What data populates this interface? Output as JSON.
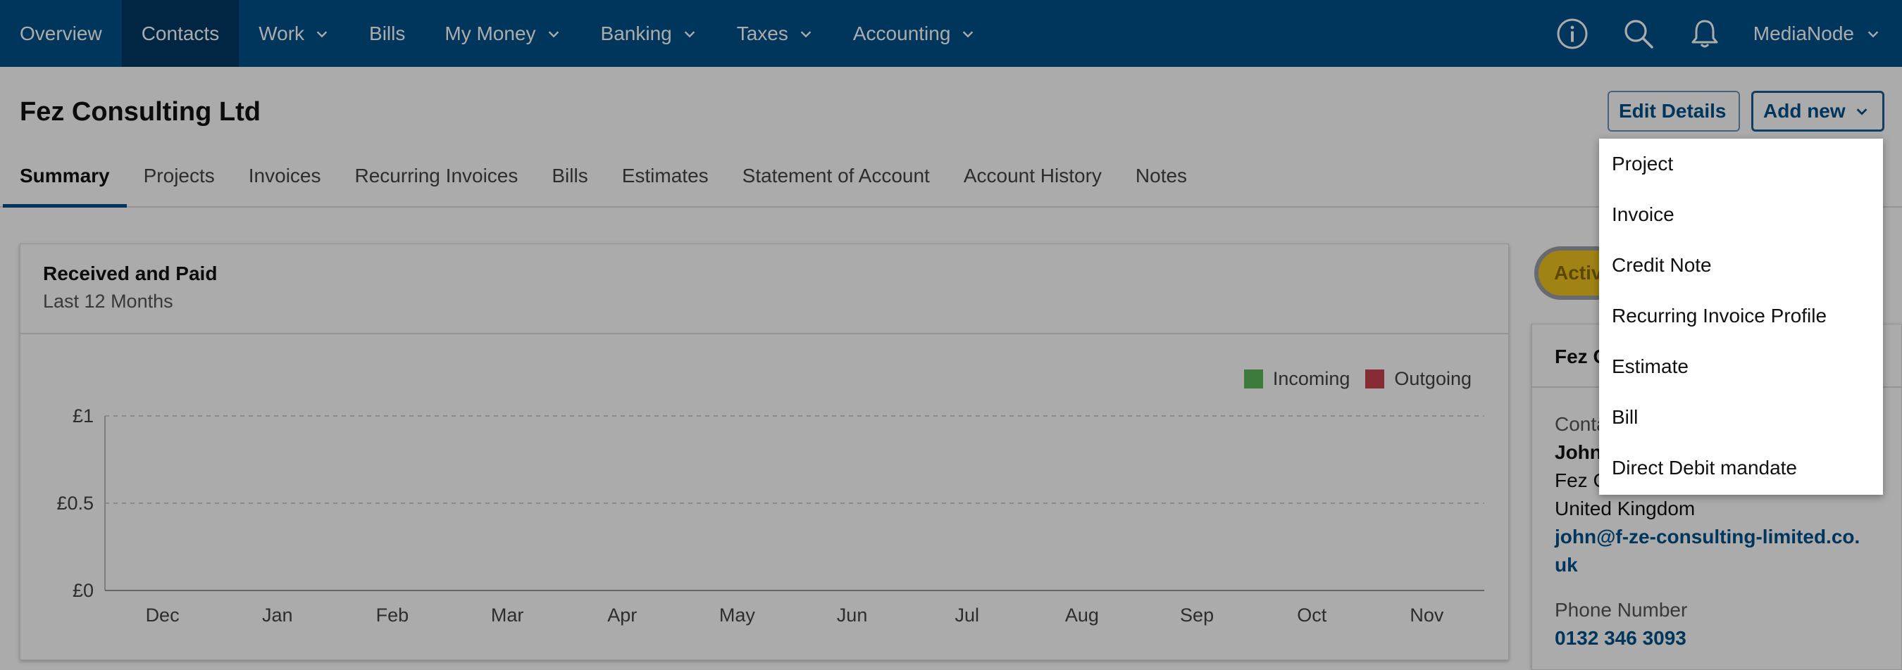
{
  "nav": {
    "items": [
      {
        "label": "Overview",
        "dropdown": false,
        "active": false
      },
      {
        "label": "Contacts",
        "dropdown": false,
        "active": true
      },
      {
        "label": "Work",
        "dropdown": true,
        "active": false
      },
      {
        "label": "Bills",
        "dropdown": false,
        "active": false
      },
      {
        "label": "My Money",
        "dropdown": true,
        "active": false
      },
      {
        "label": "Banking",
        "dropdown": true,
        "active": false
      },
      {
        "label": "Taxes",
        "dropdown": true,
        "active": false
      },
      {
        "label": "Accounting",
        "dropdown": true,
        "active": false
      }
    ],
    "account_label": "MediaNode",
    "icons": [
      "info-icon",
      "search-icon",
      "bell-icon"
    ]
  },
  "header": {
    "title": "Fez Consulting Ltd",
    "edit_label": "Edit Details",
    "add_label": "Add new"
  },
  "tabs": [
    {
      "label": "Summary",
      "active": true
    },
    {
      "label": "Projects",
      "active": false
    },
    {
      "label": "Invoices",
      "active": false
    },
    {
      "label": "Recurring Invoices",
      "active": false
    },
    {
      "label": "Bills",
      "active": false
    },
    {
      "label": "Estimates",
      "active": false
    },
    {
      "label": "Statement of Account",
      "active": false
    },
    {
      "label": "Account History",
      "active": false
    },
    {
      "label": "Notes",
      "active": false
    }
  ],
  "chart_card": {
    "title": "Received and Paid",
    "subtitle": "Last 12 Months"
  },
  "chart_data": {
    "type": "bar",
    "categories": [
      "Dec",
      "Jan",
      "Feb",
      "Mar",
      "Apr",
      "May",
      "Jun",
      "Jul",
      "Aug",
      "Sep",
      "Oct",
      "Nov"
    ],
    "series": [
      {
        "name": "Incoming",
        "color": "#5cb85c",
        "values": [
          0,
          0,
          0,
          0,
          0,
          0,
          0,
          0,
          0,
          0,
          0,
          0
        ]
      },
      {
        "name": "Outgoing",
        "color": "#c9404f",
        "values": [
          0,
          0,
          0,
          0,
          0,
          0,
          0,
          0,
          0,
          0,
          0,
          0
        ]
      }
    ],
    "y_ticks": [
      "£0",
      "£0.5",
      "£1"
    ],
    "ylim": [
      0,
      1
    ],
    "grid": true,
    "legend_position": "top-right"
  },
  "side": {
    "status_label": "Activ",
    "card_title": "Fez C",
    "contact_label": "Conta",
    "contact_name": "John",
    "company_line": "Fez C",
    "country": "United Kingdom",
    "email_line1": "john@f-ze-consulting-limited.co.",
    "email_line2": "uk",
    "phone_label": "Phone Number",
    "phone": "0132 346 3093"
  },
  "dropdown": {
    "items": [
      {
        "label": "Project",
        "highlighted": false
      },
      {
        "label": "Invoice",
        "highlighted": false
      },
      {
        "label": "Credit Note",
        "highlighted": false
      },
      {
        "label": "Recurring Invoice Profile",
        "highlighted": false
      },
      {
        "label": "Estimate",
        "highlighted": false
      },
      {
        "label": "Bill",
        "highlighted": false
      },
      {
        "label": "Direct Debit mandate",
        "highlighted": true
      }
    ]
  },
  "colors": {
    "brand": "#00508a",
    "brand_dark": "#003a66",
    "status_yellow": "#f0c420"
  }
}
